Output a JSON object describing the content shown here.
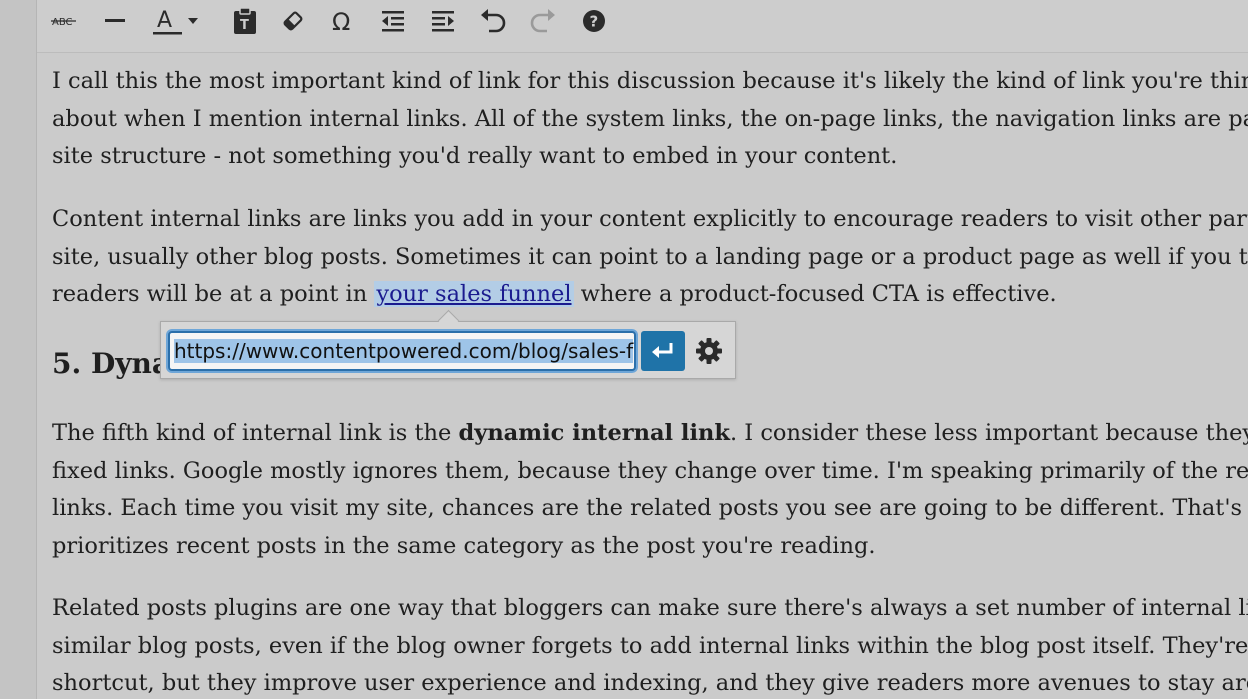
{
  "toolbar": {
    "buttons": [
      {
        "name": "strikethrough-icon",
        "glyph": "ABC"
      },
      {
        "name": "horizontal-line-icon"
      },
      {
        "name": "text-color-icon",
        "glyph": "A"
      },
      {
        "name": "text-color-dropdown-icon"
      },
      {
        "name": "paste-as-text-icon"
      },
      {
        "name": "clear-formatting-icon"
      },
      {
        "name": "special-character-icon",
        "glyph": "Ω"
      },
      {
        "name": "outdent-icon"
      },
      {
        "name": "indent-icon"
      },
      {
        "name": "undo-icon"
      },
      {
        "name": "redo-icon"
      },
      {
        "name": "help-icon",
        "glyph": "?"
      }
    ]
  },
  "content": {
    "para1": [
      "I call this the most important kind of link for this discussion because it's likely the kind of link you're thinking",
      "about when I mention internal links. All of the system links, the on-page links, the navigation links are part o",
      "site structure - not something you'd really want to embed in your content."
    ],
    "para2": {
      "line1": "Content internal links are links you add in your content explicitly to encourage readers to visit other parts of y",
      "line2": "site, usually other blog posts. Sometimes it can point to a landing page or a product page as well if you think",
      "line3_before": "readers will be at a point in ",
      "link_text": "your sales funnel",
      "line3_after": " where a product-focused CTA is effective."
    },
    "heading": "5. Dyna",
    "para3": {
      "line1_before": "The fifth kind of internal link is the ",
      "line1_bold": "dynamic internal link",
      "line1_after": ". I consider these less important because they ar",
      "line2": "fixed links. Google mostly ignores them, because they change over time. I'm speaking primarily of the related",
      "line3": "links. Each time you visit my site, chances are the related posts you see are going to be different. That's becau",
      "line4": "prioritizes recent posts in the same category as the post you're reading."
    },
    "para4": [
      "Related posts plugins are one way that bloggers can make sure there's always a set number of internal links to",
      "similar blog posts, even if the blog owner forgets to add internal links within the blog post itself. They're a bit",
      "shortcut, but they improve user experience and indexing, and they give readers more avenues to stay around"
    ]
  },
  "link_popup": {
    "url_value": "https://www.contentpowered.com/blog/sales-f",
    "apply_icon": "enter-icon",
    "settings_icon": "gear-icon"
  }
}
